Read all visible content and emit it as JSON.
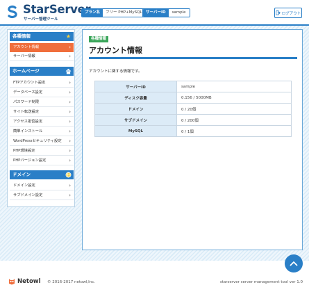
{
  "header": {
    "logo_text": "StarServer",
    "logo_sub": "サーバー管理ツール",
    "plan_label": "プラン名",
    "plan_value": "フリー  PHP+MySQL",
    "server_label": "サーバーID",
    "server_value": "sample",
    "logout_label": "ログアウト"
  },
  "sidebar": {
    "sections": [
      {
        "title": "各種情報",
        "icon": "star-icon",
        "items": [
          {
            "label": "アカウント情報",
            "active": true
          },
          {
            "label": "サーバー情報",
            "active": false
          }
        ]
      },
      {
        "title": "ホームページ",
        "icon": "home-icon",
        "items": [
          {
            "label": "FTPアカウント設定"
          },
          {
            "label": "データベース設定"
          },
          {
            "label": "パスワード制限"
          },
          {
            "label": "サイト転送設定"
          },
          {
            "label": "アクセス拒否設定"
          },
          {
            "label": "簡単インストール"
          },
          {
            "label": "WordPressセキュリティ設定"
          },
          {
            "label": "PHP環境設定"
          },
          {
            "label": "PHPバージョン設定"
          }
        ]
      },
      {
        "title": "ドメイン",
        "icon": "globe-icon",
        "items": [
          {
            "label": "ドメイン設定"
          },
          {
            "label": "サブドメイン設定"
          }
        ]
      }
    ]
  },
  "main": {
    "breadcrumb": "各種情報",
    "title": "アカウント情報",
    "description": "アカウントに関する情報です。",
    "rows": [
      {
        "key": "サーバーID",
        "value": "sample"
      },
      {
        "key": "ディスク容量",
        "value": "0.156 / 5000MB"
      },
      {
        "key": "ドメイン",
        "value": "0 / 20個"
      },
      {
        "key": "サブドメイン",
        "value": "0 / 200個"
      },
      {
        "key": "MySQL",
        "value": "0 / 1個"
      }
    ]
  },
  "footer": {
    "brand": "Netowl",
    "copyright": "© 2016-2017 netowl,Inc.",
    "version": "starserver server management tool ver 1.0"
  },
  "colors": {
    "accent": "#2a7fc7",
    "active_item": "#f06e3c",
    "breadcrumb": "#3aa55a"
  }
}
